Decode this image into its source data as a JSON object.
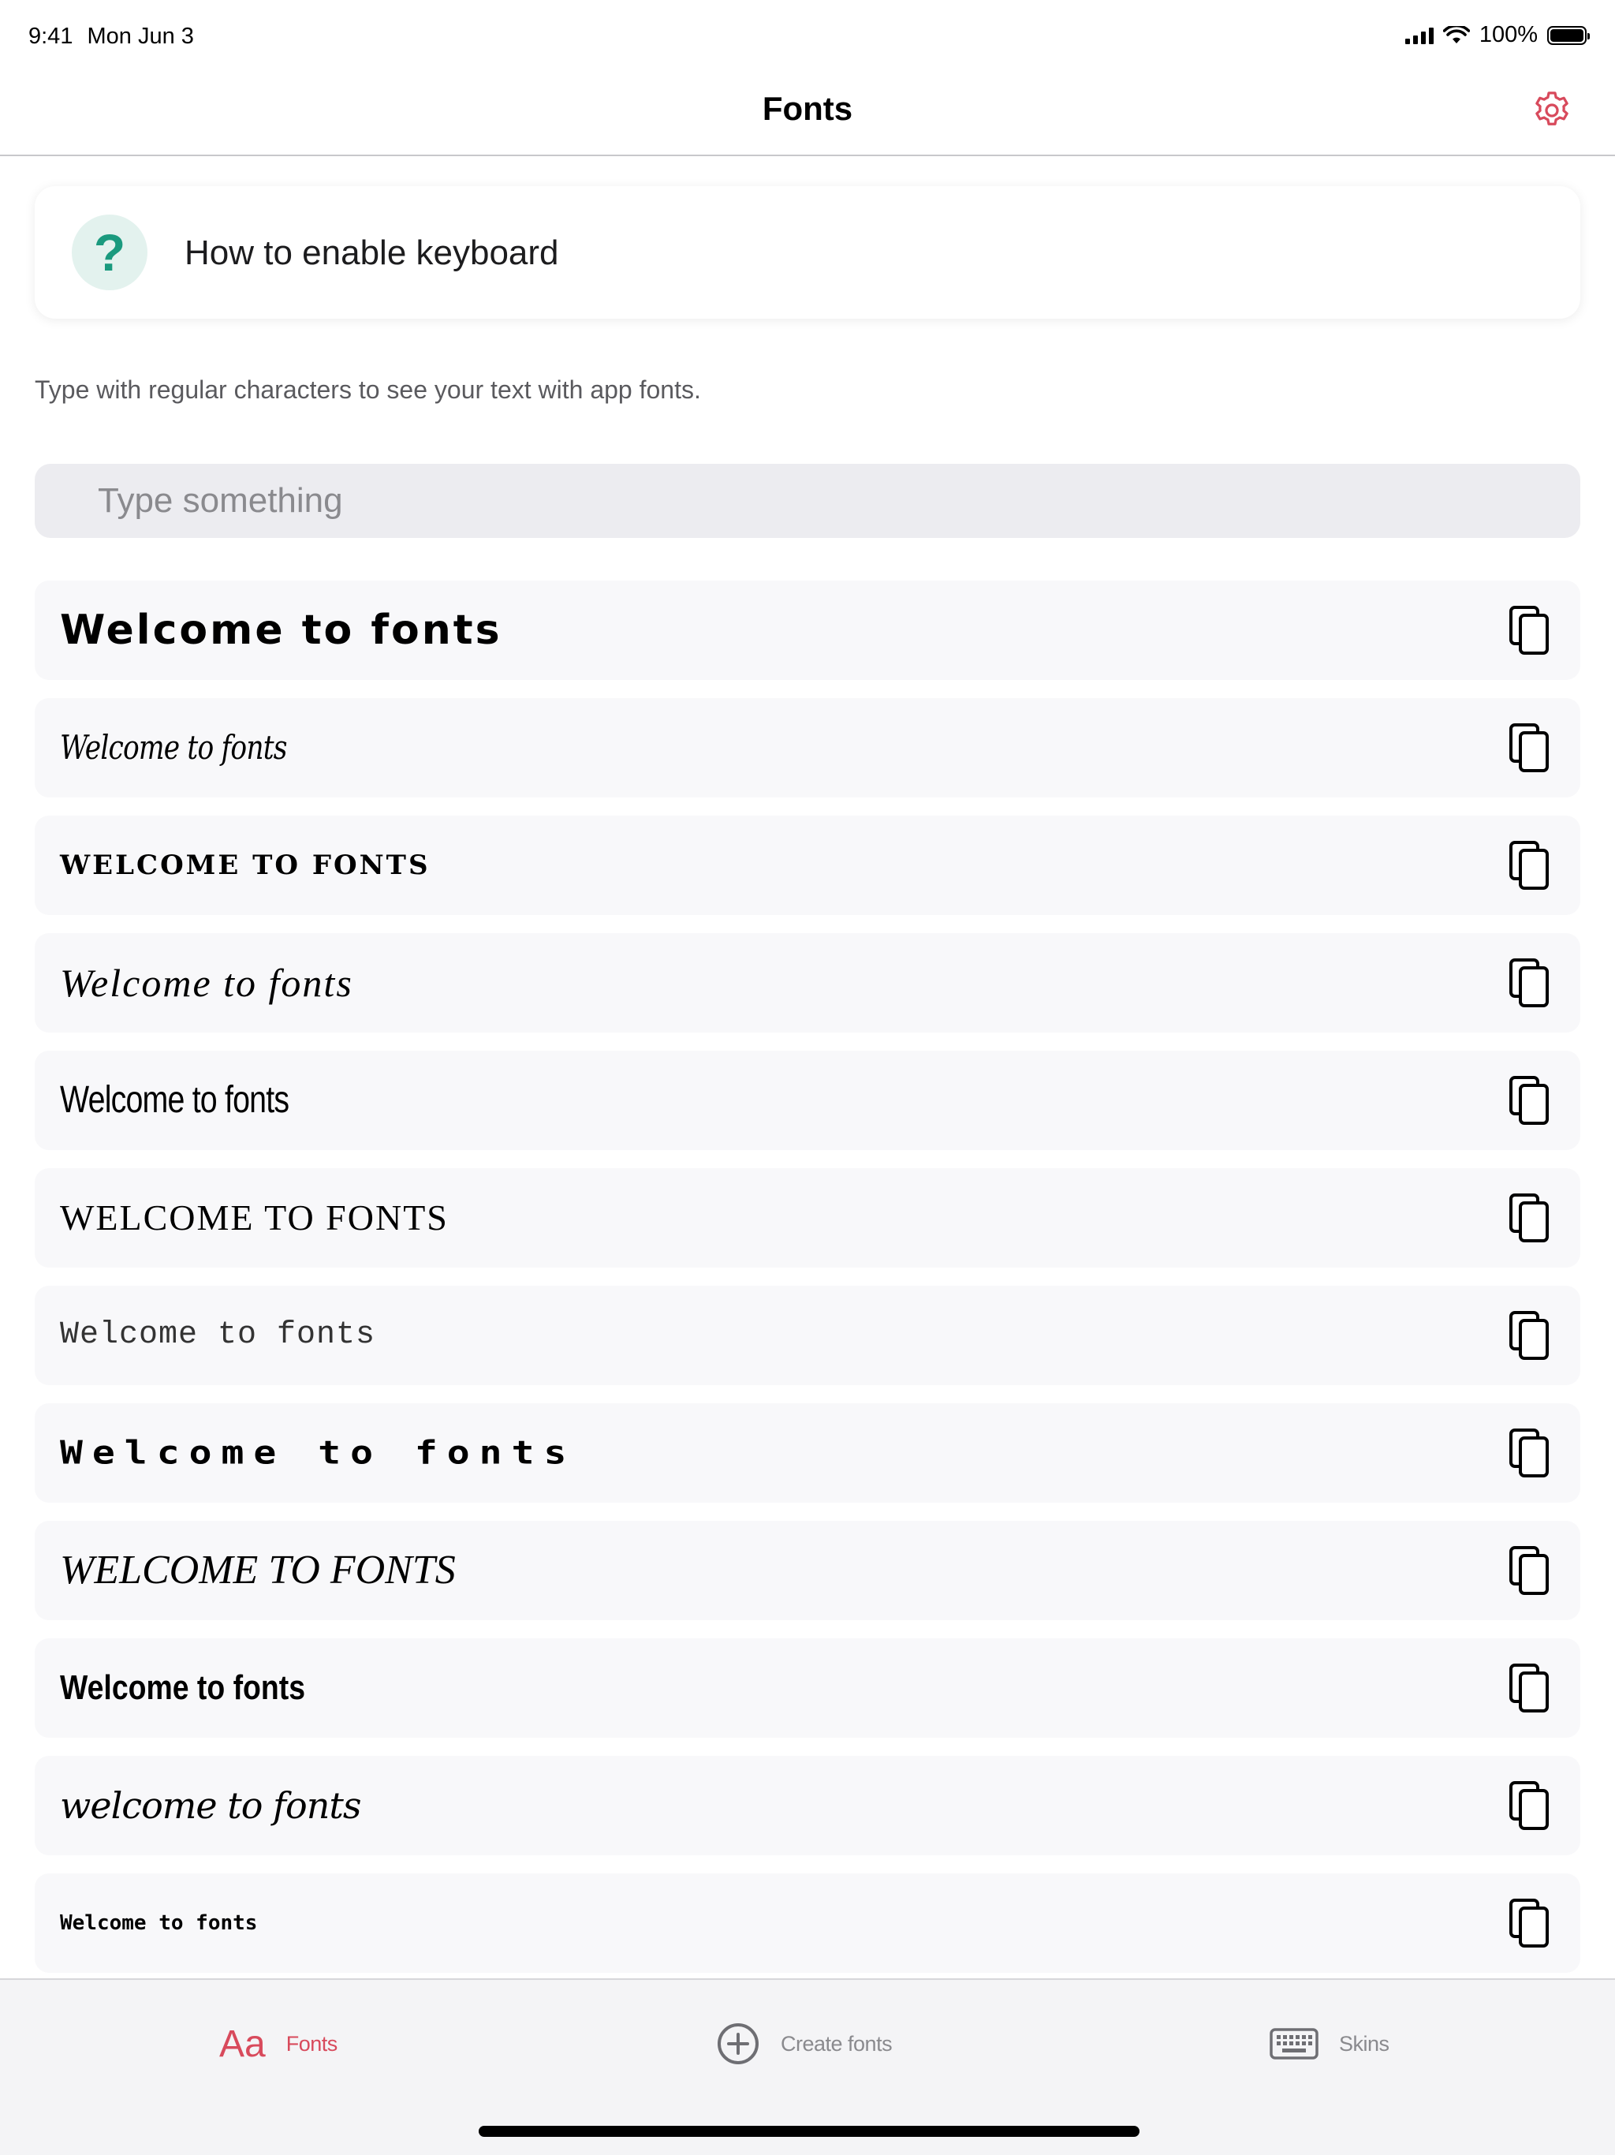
{
  "status_bar": {
    "time": "9:41",
    "date": "Mon Jun 3",
    "battery": "100%"
  },
  "nav": {
    "title": "Fonts",
    "settings_icon": "gear-icon"
  },
  "help_card": {
    "icon": "?",
    "label": "How to enable keyboard"
  },
  "hint": "Type with regular characters to see your text with app fonts.",
  "input": {
    "placeholder": "Type something",
    "value": ""
  },
  "font_samples": [
    "Welcome to fonts",
    "Welcome to fonts",
    "WELCOME TO FONTS",
    "Welcome to fonts",
    "Welcome to fonts",
    "WELCOME TO FONTS",
    "Welcome to fonts",
    "Welcome to fonts",
    "WELCOME TO FONTS",
    "Welcome to fonts",
    "welcome to fonts",
    "Welcome to fonts"
  ],
  "tabs": [
    {
      "label": "Fonts",
      "icon": "Aa",
      "active": true
    },
    {
      "label": "Create fonts",
      "icon": "plus-circle-icon",
      "active": false
    },
    {
      "label": "Skins",
      "icon": "keyboard-icon",
      "active": false
    }
  ],
  "colors": {
    "accent": "#d84a5c",
    "help_icon": "#1a9a7e",
    "help_icon_bg": "#e3f2ee",
    "row_bg": "#f8f8fa"
  }
}
